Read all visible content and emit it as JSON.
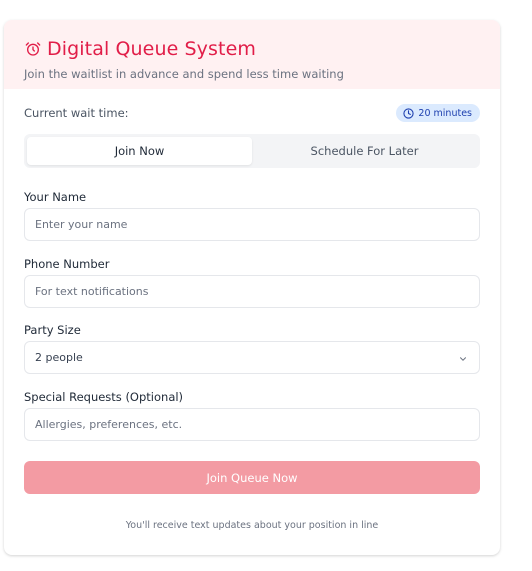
{
  "header": {
    "title": "Digital Queue System",
    "subtitle": "Join the waitlist in advance and spend less time waiting",
    "icon": "alarm-clock-icon"
  },
  "wait": {
    "label": "Current wait time:",
    "badge": "20 minutes",
    "icon": "clock-icon"
  },
  "tabs": [
    {
      "label": "Join Now",
      "active": true
    },
    {
      "label": "Schedule For Later",
      "active": false
    }
  ],
  "form": {
    "name": {
      "label": "Your Name",
      "placeholder": "Enter your name"
    },
    "phone": {
      "label": "Phone Number",
      "placeholder": "For text notifications"
    },
    "party": {
      "label": "Party Size",
      "value": "2 people"
    },
    "requests": {
      "label": "Special Requests (Optional)",
      "placeholder": "Allergies, preferences, etc."
    },
    "submit_label": "Join Queue Now"
  },
  "footnote": "You'll receive text updates about your position in line",
  "colors": {
    "accent": "#e11d48",
    "header_bg": "#fff1f2",
    "badge_bg": "#dbeafe",
    "button_bg": "#f39ba3"
  }
}
